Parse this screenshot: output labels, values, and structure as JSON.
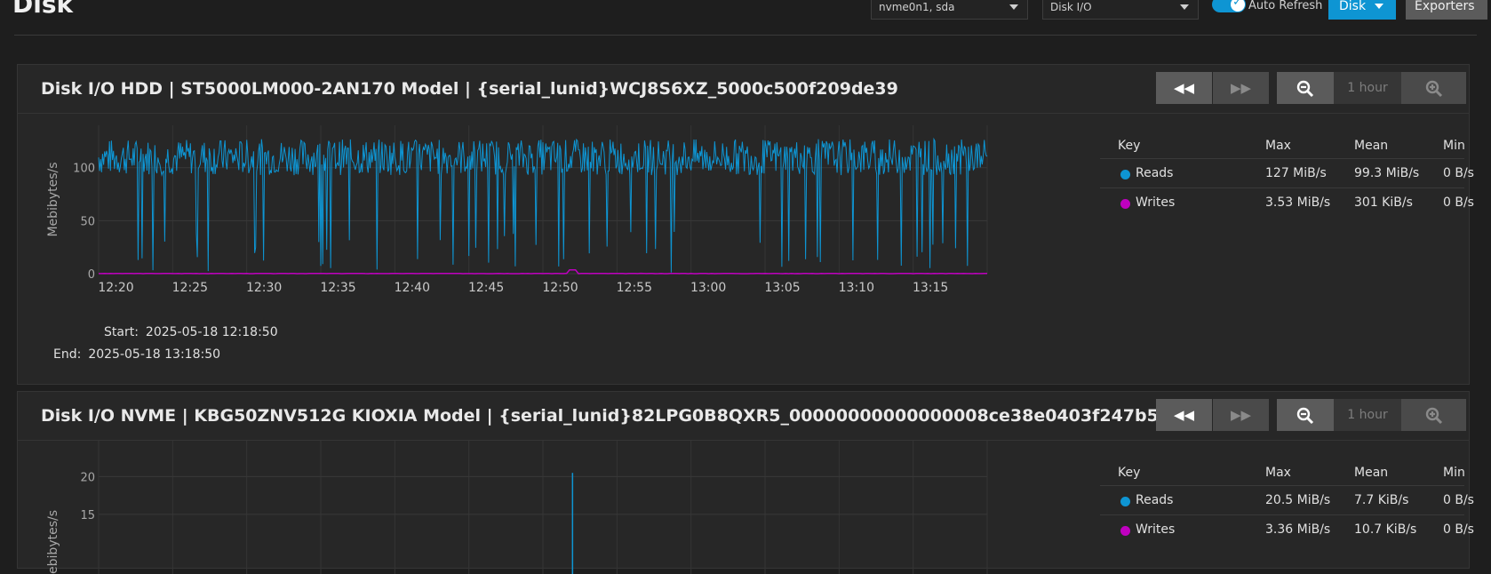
{
  "header": {
    "title": "Disk",
    "devices_select": "nvme0n1, sda",
    "metric_select": "Disk I/O",
    "auto_refresh_label": "Auto Refresh",
    "auto_refresh_on": true,
    "disk_button": "Disk",
    "exporters_button": "Exporters"
  },
  "colors": {
    "accent": "#0e95d3",
    "reads": "#0e95d3",
    "writes": "#c000c0"
  },
  "toolbar": {
    "range_label": "1 hour"
  },
  "legend_headers": {
    "key": "Key",
    "max": "Max",
    "mean": "Mean",
    "min": "Min"
  },
  "cards": [
    {
      "title": "Disk I/O HDD | ST5000LM000-2AN170 Model | {serial_lunid}WCJ8S6XZ_5000c500f209de39",
      "legend": [
        {
          "name": "Reads",
          "max": "127 MiB/s",
          "mean": "99.3 MiB/s",
          "min": "0 B/s"
        },
        {
          "name": "Writes",
          "max": "3.53 MiB/s",
          "mean": "301 KiB/s",
          "min": "0 B/s"
        }
      ],
      "start_label": "Start:",
      "start": "2025-05-18 12:18:50",
      "end_label": "End:",
      "end": "2025-05-18 13:18:50"
    },
    {
      "title": "Disk I/O NVME | KBG50ZNV512G KIOXIA Model | {serial_lunid}82LPG0B8QXR5_00000000000000008ce38e0403f247b5",
      "legend": [
        {
          "name": "Reads",
          "max": "20.5 MiB/s",
          "mean": "7.7 KiB/s",
          "min": "0 B/s"
        },
        {
          "name": "Writes",
          "max": "3.36 MiB/s",
          "mean": "10.7 KiB/s",
          "min": "0 B/s"
        }
      ]
    }
  ],
  "chart_data": [
    {
      "type": "line",
      "ylabel": "Mebibytes/s",
      "ylim": [
        0,
        140
      ],
      "yticks": [
        0,
        50,
        100
      ],
      "x_ticks": [
        "12:20",
        "12:25",
        "12:30",
        "12:35",
        "12:40",
        "12:45",
        "12:50",
        "12:55",
        "13:00",
        "13:05",
        "13:10",
        "13:15"
      ],
      "x_tick_minutes": [
        1.17,
        6.17,
        11.17,
        16.17,
        21.17,
        26.17,
        31.17,
        36.17,
        41.17,
        46.17,
        51.17,
        56.17
      ],
      "x_range_minutes": [
        0,
        60
      ],
      "series": [
        {
          "name": "Reads",
          "color": "#0e95d3",
          "approx_level": 110,
          "approx_max": 127,
          "approx_min": 0
        },
        {
          "name": "Writes",
          "color": "#c000c0",
          "approx_level": 0.3,
          "approx_max": 3.53,
          "approx_min": 0
        }
      ],
      "grid": true
    },
    {
      "type": "line",
      "ylabel": "Mebibytes/s",
      "ylim": [
        0,
        23
      ],
      "yticks": [
        15,
        20
      ],
      "x_range_minutes": [
        0,
        60
      ],
      "spike": {
        "minute": 32,
        "value": 20.5
      },
      "series": [
        {
          "name": "Reads",
          "color": "#0e95d3"
        },
        {
          "name": "Writes",
          "color": "#c000c0"
        }
      ],
      "grid": true
    }
  ]
}
